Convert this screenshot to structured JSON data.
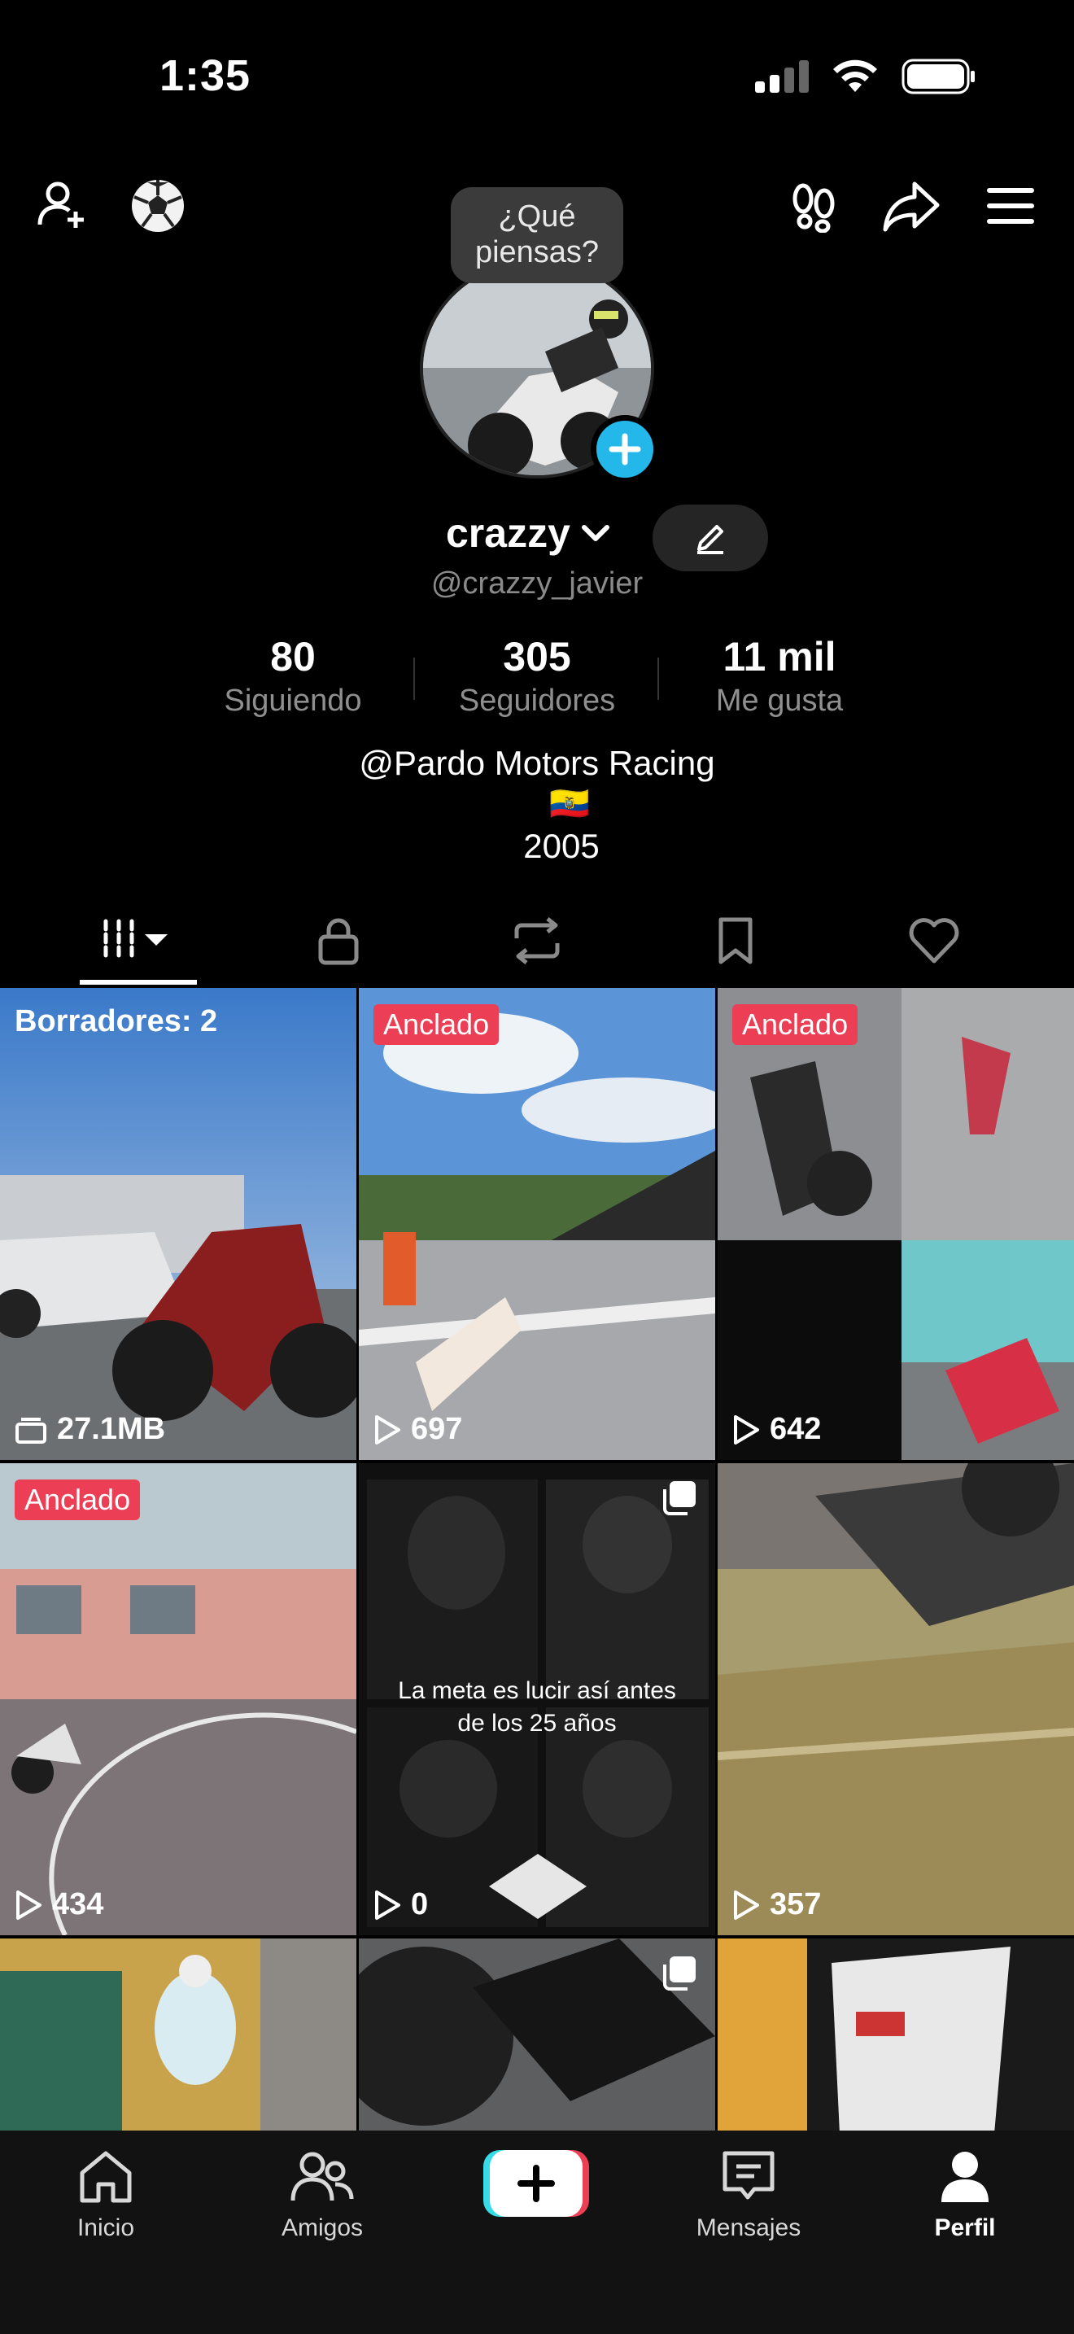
{
  "status_bar": {
    "time": "1:35"
  },
  "profile": {
    "thought_bubble": "¿Qué piensas?",
    "display_name": "crazzy",
    "handle": "@crazzy_javier",
    "stats": [
      {
        "value": "80",
        "label": "Siguiendo"
      },
      {
        "value": "305",
        "label": "Seguidores"
      },
      {
        "value": "11 mil",
        "label": "Me gusta"
      }
    ],
    "bio": {
      "line1": "@Pardo Motors Racing",
      "flag": "🇪🇨",
      "line3": "2005"
    }
  },
  "tabs": [
    {
      "name": "videos",
      "icon": "grid-icon",
      "active": true
    },
    {
      "name": "private",
      "icon": "lock-icon"
    },
    {
      "name": "reposts",
      "icon": "repost-icon"
    },
    {
      "name": "saved",
      "icon": "bookmark-icon"
    },
    {
      "name": "liked",
      "icon": "heart-icon"
    }
  ],
  "grid": {
    "drafts_label": "Borradores: 2",
    "drafts_size": "27.1MB",
    "pin_label": "Anclado",
    "items": [
      {
        "views": "697"
      },
      {
        "views": "642"
      },
      {
        "views": "434"
      },
      {
        "views": "0",
        "overlay": "La meta es lucir así antes de los 25 años"
      },
      {
        "views": "357"
      }
    ]
  },
  "bottom_nav": {
    "items": [
      {
        "label": "Inicio"
      },
      {
        "label": "Amigos"
      },
      {
        "label": "Mensajes"
      },
      {
        "label": "Perfil"
      }
    ]
  },
  "colors": {
    "accent_pink": "#ec3e54",
    "accent_cyan": "#24b7e9",
    "background": "#000000"
  }
}
